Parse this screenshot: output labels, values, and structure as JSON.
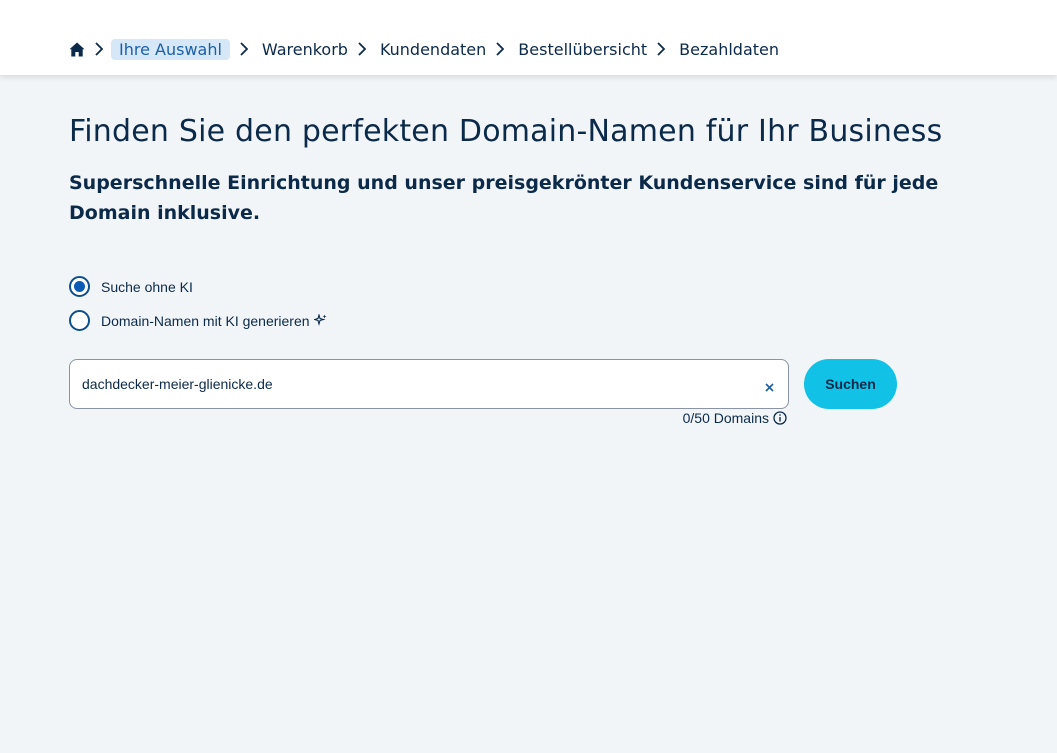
{
  "breadcrumb": {
    "items": [
      {
        "label": "Ihre Auswahl",
        "active": true
      },
      {
        "label": "Warenkorb"
      },
      {
        "label": "Kundendaten"
      },
      {
        "label": "Bestellübersicht"
      },
      {
        "label": "Bezahldaten"
      }
    ]
  },
  "hero": {
    "title": "Finden Sie den perfekten Domain-Namen für Ihr Business",
    "subtitle": "Superschnelle Einrichtung und unser preisgekrönter Kundenservice sind für jede Domain inklusive."
  },
  "search_mode": {
    "options": [
      {
        "label": "Suche ohne KI",
        "selected": true
      },
      {
        "label": "Domain-Namen mit KI generieren",
        "selected": false
      }
    ]
  },
  "search": {
    "value": "dachdecker-meier-glienicke.de",
    "button_label": "Suchen",
    "counter": "0/50 Domains"
  },
  "colors": {
    "accent_button": "#12c1e6",
    "text_primary": "#0b2a4a",
    "breadcrumb_active_bg": "#d6e8f8",
    "page_bg": "#f2f5f8"
  }
}
